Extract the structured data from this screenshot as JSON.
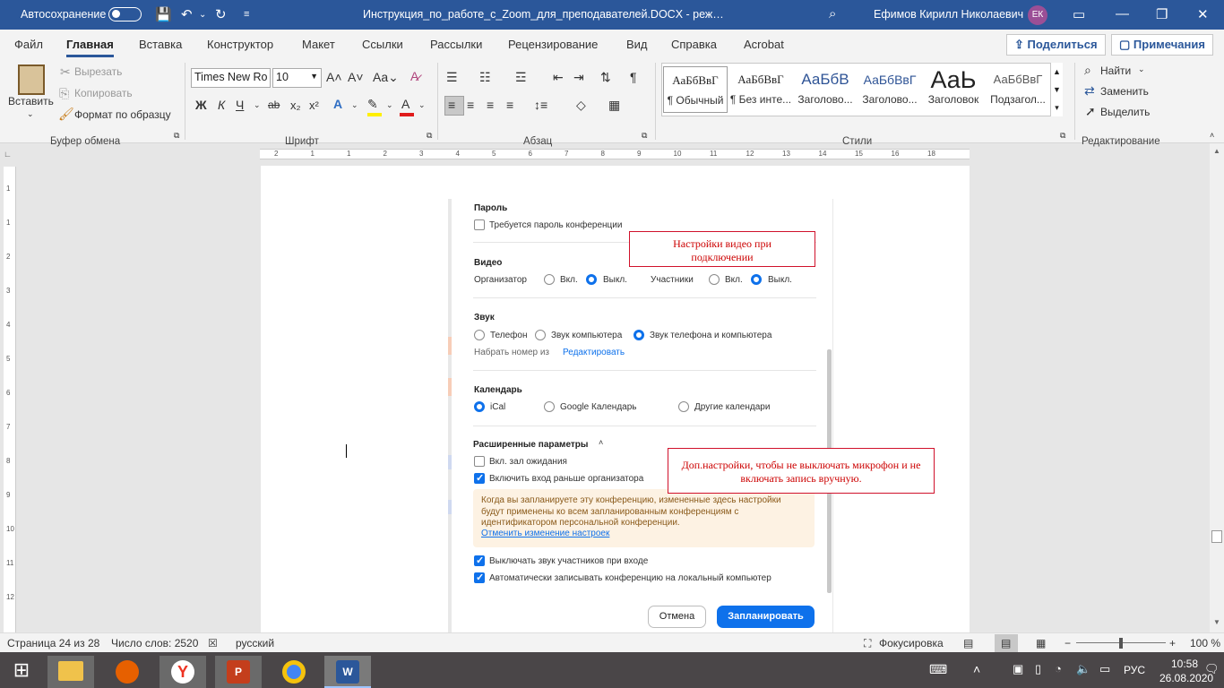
{
  "titlebar": {
    "autosave": "Автосохранение",
    "doc_title": "Инструкция_по_работе_с_Zoom_для_преподавателей.DOCX  -  реж…",
    "user_name": "Ефимов Кирилл Николаевич",
    "user_initials": "ЕК"
  },
  "tabs": [
    "Файл",
    "Главная",
    "Вставка",
    "Конструктор",
    "Макет",
    "Ссылки",
    "Рассылки",
    "Рецензирование",
    "Вид",
    "Справка",
    "Acrobat"
  ],
  "share": "Поделиться",
  "comments": "Примечания",
  "ribbon": {
    "paste": "Вставить",
    "cut": "Вырезать",
    "copy": "Копировать",
    "format_painter": "Формат по образцу",
    "clipboard_group": "Буфер обмена",
    "font_name": "Times New Ro",
    "font_size": "10",
    "font_group": "Шрифт",
    "paragraph_group": "Абзац",
    "styles_group": "Стили",
    "editing_group": "Редактирование",
    "find": "Найти",
    "replace": "Заменить",
    "select": "Выделить",
    "bold": "Ж",
    "italic": "К",
    "underline": "Ч",
    "styles": [
      {
        "preview": "АаБбВвГ",
        "name": "¶ Обычный"
      },
      {
        "preview": "АаБбВвГ",
        "name": "¶ Без инте..."
      },
      {
        "preview": "АаБбВ",
        "name": "Заголово..."
      },
      {
        "preview": "АаБбВвГ",
        "name": "Заголово..."
      },
      {
        "preview": "АаЬ",
        "name": "Заголовок"
      },
      {
        "preview": "АаБбВвГ",
        "name": "Подзагол..."
      }
    ]
  },
  "ruler": {
    "h_marks": [
      "2",
      "1",
      "1",
      "2",
      "3",
      "4",
      "5",
      "6",
      "7",
      "8",
      "9",
      "10",
      "11",
      "12",
      "13",
      "14",
      "15",
      "16",
      "18"
    ],
    "v_marks": [
      "1",
      "1",
      "2",
      "3",
      "4",
      "5",
      "6",
      "7",
      "8",
      "9",
      "10",
      "11",
      "12"
    ]
  },
  "zoom": {
    "password_header": "Пароль",
    "password_check": "Требуется пароль конференции",
    "video_header": "Видео",
    "host": "Организатор",
    "on": "Вкл.",
    "off": "Выкл.",
    "participants": "Участники",
    "audio_header": "Звук",
    "phone": "Телефон",
    "computer_audio": "Звук компьютера",
    "both_audio": "Звук телефона и компьютера",
    "dial_from": "Набрать номер из",
    "edit": "Редактировать",
    "calendar_header": "Календарь",
    "ical": "iCal",
    "google_cal": "Google Календарь",
    "other_cal": "Другие календари",
    "advanced_header": "Расширенные параметры",
    "waiting_room": "Вкл. зал ожидания",
    "join_before_host": "Включить вход раньше организатора",
    "info_text": "Когда вы запланируете эту конференцию, измененные здесь настройки будут применены ко всем запланированным конференциям с идентификатором персональной конференции.",
    "info_link": "Отменить изменение настроек",
    "mute_on_entry": "Выключать звук участников при входе",
    "auto_record": "Автоматически записывать конференцию на локальный компьютер",
    "cancel": "Отмена",
    "schedule": "Запланировать"
  },
  "notes": {
    "video_note": "Настройки видео при подключении",
    "advanced_note": "Доп.настройки, чтобы не выключать микрофон и не включать запись вручную."
  },
  "status": {
    "page": "Страница 24 из 28",
    "words": "Число слов: 2520",
    "language": "русский",
    "focus": "Фокусировка",
    "zoom": "100 %"
  },
  "taskbar": {
    "lang": "РУС",
    "time": "10:58",
    "date": "26.08.2020"
  },
  "colors": {
    "word_blue": "#2b579a",
    "zoom_blue": "#0e71eb",
    "annotation_red": "#d0112b"
  }
}
